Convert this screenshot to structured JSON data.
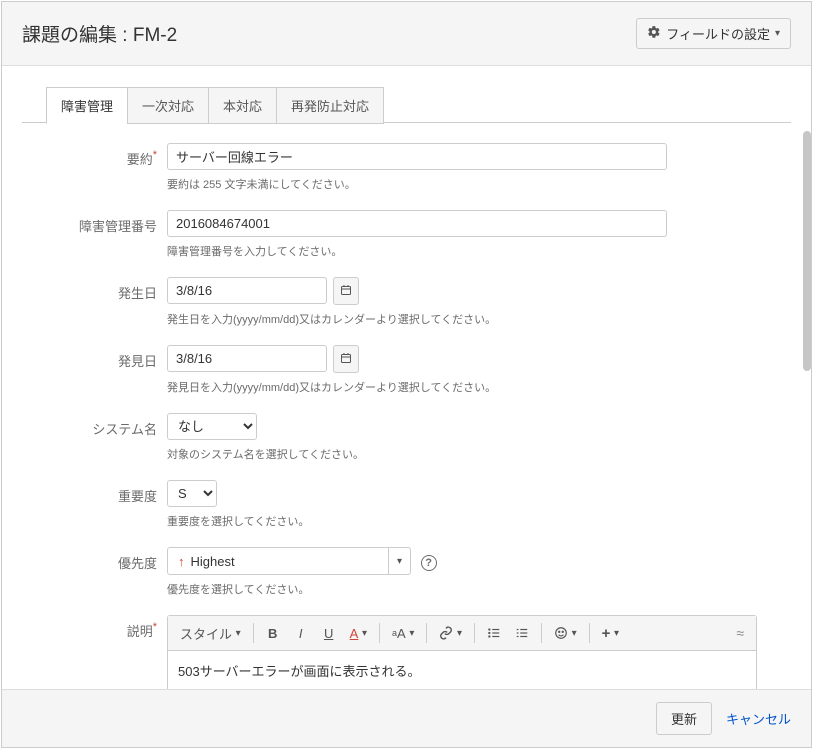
{
  "header": {
    "title": "課題の編集 : FM-2",
    "config_label": "フィールドの設定"
  },
  "tabs": [
    "障害管理",
    "一次対応",
    "本対応",
    "再発防止対応"
  ],
  "fields": {
    "summary": {
      "label": "要約",
      "value": "サーバー回線エラー",
      "help": "要約は 255 文字未満にしてください。"
    },
    "incident_no": {
      "label": "障害管理番号",
      "value": "2016084674001",
      "help": "障害管理番号を入力してください。"
    },
    "occurred": {
      "label": "発生日",
      "value": "3/8/16",
      "help": "発生日を入力(yyyy/mm/dd)又はカレンダーより選択してください。"
    },
    "discovered": {
      "label": "発見日",
      "value": "3/8/16",
      "help": "発見日を入力(yyyy/mm/dd)又はカレンダーより選択してください。"
    },
    "system": {
      "label": "システム名",
      "value": "なし",
      "help": "対象のシステム名を選択してください。"
    },
    "severity": {
      "label": "重要度",
      "value": "S",
      "help": "重要度を選択してください。"
    },
    "priority": {
      "label": "優先度",
      "value": "Highest",
      "help": "優先度を選択してください。"
    },
    "description": {
      "label": "説明",
      "value": "503サーバーエラーが画面に表示される。"
    }
  },
  "rte": {
    "style_label": "スタイル"
  },
  "footer": {
    "submit": "更新",
    "cancel": "キャンセル"
  }
}
